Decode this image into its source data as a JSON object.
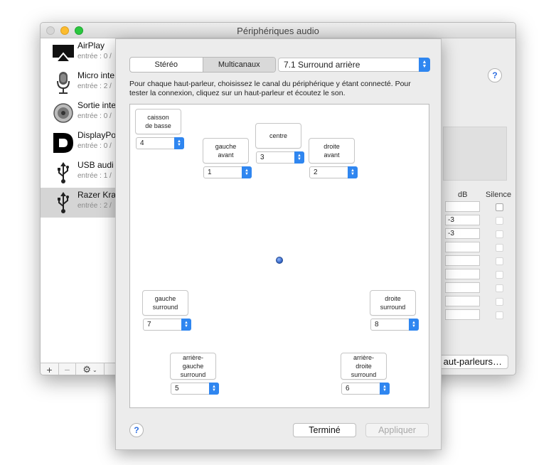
{
  "window": {
    "title": "Périphériques audio"
  },
  "devices": [
    {
      "name": "AirPlay",
      "sub": "entrée : 0 /",
      "icon": "airplay-icon"
    },
    {
      "name": "Micro inte",
      "sub": "entrée : 2 /",
      "icon": "microphone-icon"
    },
    {
      "name": "Sortie inte",
      "sub": "entrée : 0 /",
      "icon": "speaker-icon"
    },
    {
      "name": "DisplayPo",
      "sub": "entrée : 0 /",
      "icon": "displayport-icon"
    },
    {
      "name": "USB audi",
      "sub": "entrée : 1 /",
      "icon": "usb-icon"
    },
    {
      "name": "Razer Kra",
      "sub": "entrée : 2 /",
      "icon": "usb-icon",
      "selected": true
    }
  ],
  "sidebar_bottom": {
    "add": "+",
    "remove": "−",
    "gear": "⚙"
  },
  "table": {
    "db_header": "dB",
    "silence_header": "Silence",
    "rows": [
      {
        "db": ""
      },
      {
        "db": "-3"
      },
      {
        "db": "-3"
      },
      {
        "db": ""
      },
      {
        "db": ""
      },
      {
        "db": ""
      },
      {
        "db": ""
      },
      {
        "db": ""
      },
      {
        "db": ""
      }
    ]
  },
  "configure_speakers_label": "aut-parleurs…",
  "help_label": "?",
  "sheet": {
    "tabs": [
      {
        "label": "Stéréo",
        "active": false
      },
      {
        "label": "Multicanaux",
        "active": true
      }
    ],
    "preset": "7.1 Surround arrière",
    "instruction_line1": "Pour chaque haut-parleur, choisissez le canal du périphérique y étant connecté. Pour",
    "instruction_line2": "tester la connexion, cliquez sur un haut-parleur et écoutez le son.",
    "speakers": {
      "subwoofer": {
        "label1": "caisson",
        "label2": "de basse",
        "channel": "4"
      },
      "front_left": {
        "label1": "gauche",
        "label2": "avant",
        "channel": "1"
      },
      "center": {
        "label1": "centre",
        "channel": "3"
      },
      "front_right": {
        "label1": "droite",
        "label2": "avant",
        "channel": "2"
      },
      "left_surround": {
        "label1": "gauche",
        "label2": "surround",
        "channel": "7"
      },
      "right_surround": {
        "label1": "droite",
        "label2": "surround",
        "channel": "8"
      },
      "rear_left": {
        "label1": "arrière-",
        "label2": "gauche",
        "label3": "surround",
        "channel": "5"
      },
      "rear_right": {
        "label1": "arrière-",
        "label2": "droite",
        "label3": "surround",
        "channel": "6"
      }
    },
    "done_label": "Terminé",
    "apply_label": "Appliquer"
  },
  "colors": {
    "accent": "#2f86f0"
  }
}
